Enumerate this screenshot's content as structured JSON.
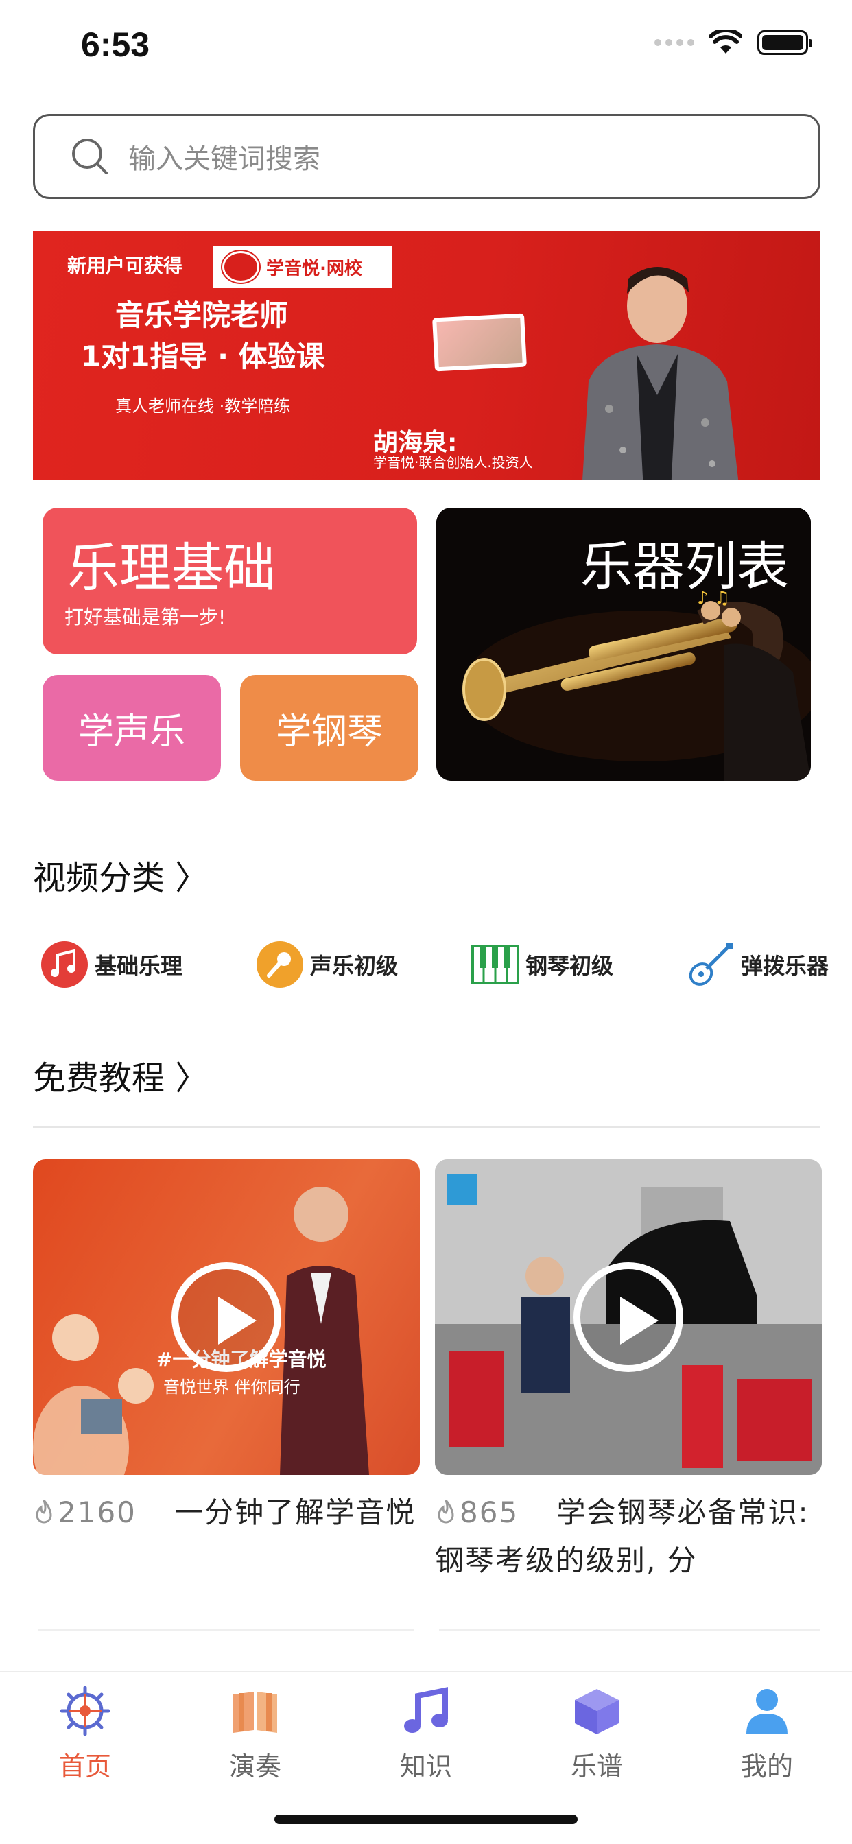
{
  "status_bar": {
    "time": "6:53"
  },
  "search": {
    "placeholder": "输入关键词搜索"
  },
  "banner": {
    "new_user": "新用户可获得",
    "logo_text": "学音悦·网校",
    "headline_1": "音乐学院老师",
    "headline_2": "1对1指导 · 体验课",
    "subtext": "真人老师在线 ·教学陪练",
    "person_name": "胡海泉:",
    "person_role": "学音悦·联合创始人.投资人"
  },
  "feature_cards": {
    "theory": {
      "title": "乐理基础",
      "subtitle": "打好基础是第一步!"
    },
    "vocal": {
      "label": "学声乐"
    },
    "piano": {
      "label": "学钢琴"
    },
    "instruments": {
      "title": "乐器列表"
    }
  },
  "sections": {
    "video_categories": "视频分类 〉",
    "free_tutorials": "免费教程 〉"
  },
  "categories": [
    {
      "label": "基础乐理",
      "icon": "music-note-icon"
    },
    {
      "label": "声乐初级",
      "icon": "microphone-icon"
    },
    {
      "label": "钢琴初级",
      "icon": "piano-keys-icon"
    },
    {
      "label": "弹拨乐器",
      "icon": "guitar-icon"
    }
  ],
  "videos": [
    {
      "likes": "2160",
      "title": "一分钟了解学音悦",
      "overlay_text": "#一分钟了解学音悦",
      "overlay_sub": "音悦世界 伴你同行"
    },
    {
      "likes": "865",
      "title": "学会钢琴必备常识: 钢琴考级的级别, 分"
    }
  ],
  "tabs": [
    {
      "label": "首页",
      "icon": "home-wheel-icon",
      "active": true
    },
    {
      "label": "演奏",
      "icon": "book-icon",
      "active": false
    },
    {
      "label": "知识",
      "icon": "music-note-icon",
      "active": false
    },
    {
      "label": "乐谱",
      "icon": "cube-icon",
      "active": false
    },
    {
      "label": "我的",
      "icon": "user-icon",
      "active": false
    }
  ],
  "colors": {
    "accent": "#e8593a",
    "banner_red": "#d8201c",
    "theory_card": "#f0535a",
    "vocal_card": "#ea6aa6",
    "piano_card": "#ef8c48"
  }
}
